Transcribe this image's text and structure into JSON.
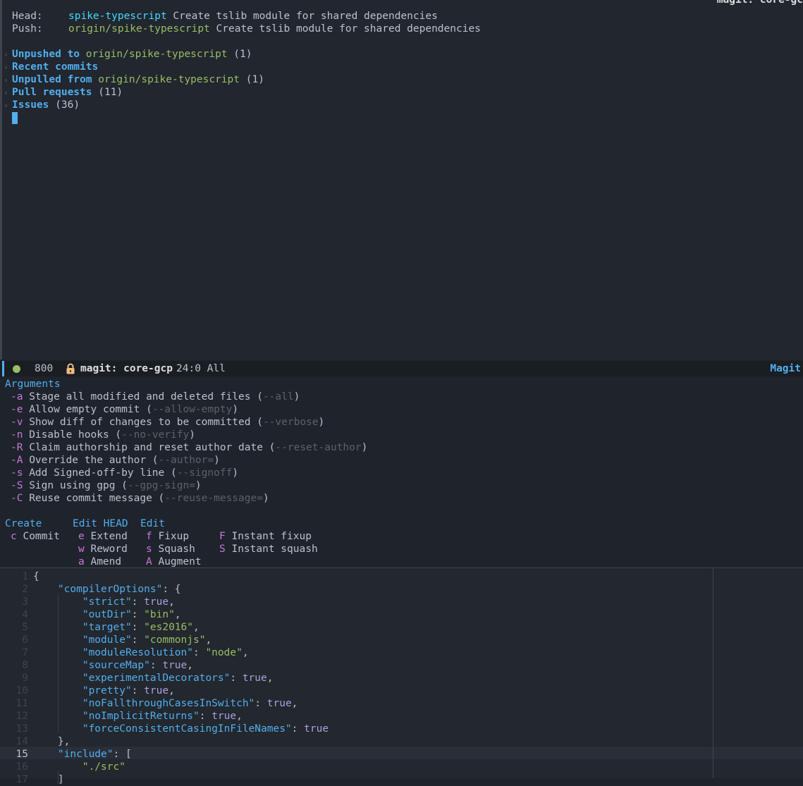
{
  "window_title": "magit: core-gc",
  "status": {
    "head_label": "Head:",
    "head_branch": "spike-typescript",
    "head_message": "Create tslib module for shared dependencies",
    "push_label": "Push:",
    "push_branch": "origin/spike-typescript",
    "push_message": "Create tslib module for shared dependencies",
    "sections": [
      {
        "title": "Unpushed to",
        "ref": "origin/spike-typescript",
        "count": "(1)"
      },
      {
        "title": "Recent commits",
        "ref": "",
        "count": ""
      },
      {
        "title": "Unpulled from",
        "ref": "origin/spike-typescript",
        "count": "(1)"
      },
      {
        "title": "Pull requests",
        "ref": "",
        "count": "(11)"
      },
      {
        "title": "Issues",
        "ref": "",
        "count": "(36)"
      }
    ]
  },
  "modeline": {
    "count": "800",
    "buffer": "magit: core-gcp",
    "position": "24:0 All",
    "mode": "Magit"
  },
  "transient": {
    "arguments_title": "Arguments",
    "arguments": [
      {
        "key": "-a",
        "desc": "Stage all modified and deleted files",
        "flag": "--all"
      },
      {
        "key": "-e",
        "desc": "Allow empty commit",
        "flag": "--allow-empty"
      },
      {
        "key": "-v",
        "desc": "Show diff of changes to be committed",
        "flag": "--verbose"
      },
      {
        "key": "-n",
        "desc": "Disable hooks",
        "flag": "--no-verify"
      },
      {
        "key": "-R",
        "desc": "Claim authorship and reset author date",
        "flag": "--reset-author"
      },
      {
        "key": "-A",
        "desc": "Override the author",
        "flag": "--author="
      },
      {
        "key": "-s",
        "desc": "Add Signed-off-by line",
        "flag": "--signoff"
      },
      {
        "key": "-S",
        "desc": "Sign using gpg",
        "flag": "--gpg-sign="
      },
      {
        "key": "-C",
        "desc": "Reuse commit message",
        "flag": "--reuse-message="
      }
    ],
    "groups": {
      "create_title": "Create",
      "edit_head_title": "Edit HEAD",
      "edit_title": "Edit",
      "create": [
        {
          "key": "c",
          "label": "Commit"
        }
      ],
      "edit_head": [
        {
          "key": "e",
          "label": "Extend"
        },
        {
          "key": "w",
          "label": "Reword"
        },
        {
          "key": "a",
          "label": "Amend"
        }
      ],
      "edit": [
        {
          "key": "f",
          "label": "Fixup"
        },
        {
          "key": "s",
          "label": "Squash"
        },
        {
          "key": "A",
          "label": "Augment"
        }
      ],
      "instant": [
        {
          "key": "F",
          "label": "Instant fixup"
        },
        {
          "key": "S",
          "label": "Instant squash"
        }
      ]
    }
  },
  "editor": {
    "current_line": "15",
    "line_numbers": [
      "1",
      "2",
      "3",
      "4",
      "5",
      "6",
      "7",
      "8",
      "9",
      "10",
      "11",
      "12",
      "13",
      "14",
      "15",
      "16",
      "17"
    ],
    "lines": [
      {
        "indent": "",
        "key": "",
        "sep": "{",
        "val": "",
        "vclass": "",
        "tail": ""
      },
      {
        "indent": "    ",
        "key": "\"compilerOptions\"",
        "sep": ": {",
        "val": "",
        "vclass": "",
        "tail": ""
      },
      {
        "indent": "        ",
        "key": "\"strict\"",
        "sep": ": ",
        "val": "true",
        "vclass": "kw",
        "tail": ","
      },
      {
        "indent": "        ",
        "key": "\"outDir\"",
        "sep": ": ",
        "val": "\"bin\"",
        "vclass": "str",
        "tail": ","
      },
      {
        "indent": "        ",
        "key": "\"target\"",
        "sep": ": ",
        "val": "\"es2016\"",
        "vclass": "str",
        "tail": ","
      },
      {
        "indent": "        ",
        "key": "\"module\"",
        "sep": ": ",
        "val": "\"commonjs\"",
        "vclass": "str",
        "tail": ","
      },
      {
        "indent": "        ",
        "key": "\"moduleResolution\"",
        "sep": ": ",
        "val": "\"node\"",
        "vclass": "str",
        "tail": ","
      },
      {
        "indent": "        ",
        "key": "\"sourceMap\"",
        "sep": ": ",
        "val": "true",
        "vclass": "kw",
        "tail": ","
      },
      {
        "indent": "        ",
        "key": "\"experimentalDecorators\"",
        "sep": ": ",
        "val": "true",
        "vclass": "kw",
        "tail": ","
      },
      {
        "indent": "        ",
        "key": "\"pretty\"",
        "sep": ": ",
        "val": "true",
        "vclass": "kw",
        "tail": ","
      },
      {
        "indent": "        ",
        "key": "\"noFallthroughCasesInSwitch\"",
        "sep": ": ",
        "val": "true",
        "vclass": "kw",
        "tail": ","
      },
      {
        "indent": "        ",
        "key": "\"noImplicitReturns\"",
        "sep": ": ",
        "val": "true",
        "vclass": "kw",
        "tail": ","
      },
      {
        "indent": "        ",
        "key": "\"forceConsistentCasingInFileNames\"",
        "sep": ": ",
        "val": "true",
        "vclass": "kw",
        "tail": ""
      },
      {
        "indent": "    ",
        "key": "",
        "sep": "},",
        "val": "",
        "vclass": "",
        "tail": ""
      },
      {
        "indent": "    ",
        "key": "\"include\"",
        "sep": ": [",
        "val": "",
        "vclass": "",
        "tail": ""
      },
      {
        "indent": "        ",
        "key": "",
        "sep": "",
        "val": "\"./src\"",
        "vclass": "str",
        "tail": ""
      },
      {
        "indent": "    ",
        "key": "",
        "sep": "]",
        "val": "",
        "vclass": "",
        "tail": ""
      }
    ]
  },
  "colors": {
    "background": "#1f232b",
    "accent_blue": "#51afef",
    "branch_cyan": "#46d9ff",
    "remote_green": "#98be65",
    "key_purple": "#c678dd"
  }
}
